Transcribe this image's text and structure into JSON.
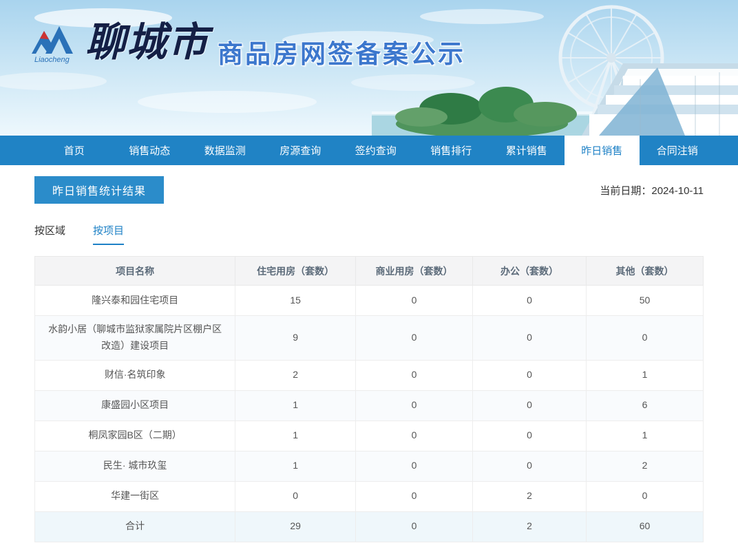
{
  "header": {
    "logo_text": "Liaocheng",
    "site_calligraphy": "聊城市",
    "site_title": "商品房网签备案公示"
  },
  "nav": {
    "items": [
      {
        "name": "home",
        "label": "首页",
        "active": false
      },
      {
        "name": "sales-dynamics",
        "label": "销售动态",
        "active": false
      },
      {
        "name": "data-monitoring",
        "label": "数据监测",
        "active": false
      },
      {
        "name": "listing-query",
        "label": "房源查询",
        "active": false
      },
      {
        "name": "signing-query",
        "label": "签约查询",
        "active": false
      },
      {
        "name": "sales-ranking",
        "label": "销售排行",
        "active": false
      },
      {
        "name": "cumulative-sales",
        "label": "累计销售",
        "active": false
      },
      {
        "name": "yesterday-sales",
        "label": "昨日销售",
        "active": true
      },
      {
        "name": "contract-cancellation",
        "label": "合同注销",
        "active": false
      }
    ]
  },
  "main": {
    "section_title": "昨日销售统计结果",
    "current_date_label": "当前日期：2024-10-11",
    "tabs": [
      {
        "name": "by-region",
        "label": "按区域",
        "active": false
      },
      {
        "name": "by-project",
        "label": "按项目",
        "active": true
      }
    ],
    "table": {
      "headers": [
        "项目名称",
        "住宅用房（套数）",
        "商业用房（套数）",
        "办公（套数）",
        "其他（套数）"
      ],
      "rows": [
        {
          "cells": [
            "隆兴泰和园住宅项目",
            "15",
            "0",
            "0",
            "50"
          ],
          "total": false
        },
        {
          "cells": [
            "水韵小居（聊城市监狱家属院片区棚户区改造）建设项目",
            "9",
            "0",
            "0",
            "0"
          ],
          "total": false
        },
        {
          "cells": [
            "财信·名筑印象",
            "2",
            "0",
            "0",
            "1"
          ],
          "total": false
        },
        {
          "cells": [
            "康盛园小区项目",
            "1",
            "0",
            "0",
            "6"
          ],
          "total": false
        },
        {
          "cells": [
            "桐凤家园B区（二期）",
            "1",
            "0",
            "0",
            "1"
          ],
          "total": false
        },
        {
          "cells": [
            "民生· 城市玖玺",
            "1",
            "0",
            "0",
            "2"
          ],
          "total": false
        },
        {
          "cells": [
            "华建一街区",
            "0",
            "0",
            "2",
            "0"
          ],
          "total": false
        },
        {
          "cells": [
            "合计",
            "29",
            "0",
            "2",
            "60"
          ],
          "total": true
        }
      ]
    }
  },
  "colors": {
    "nav_blue": "#2083c5",
    "accent_blue": "#1e81c6",
    "badge_blue": "#2b8cca",
    "title_blue": "#3c77cd",
    "calligraphy_navy": "#141f45"
  }
}
